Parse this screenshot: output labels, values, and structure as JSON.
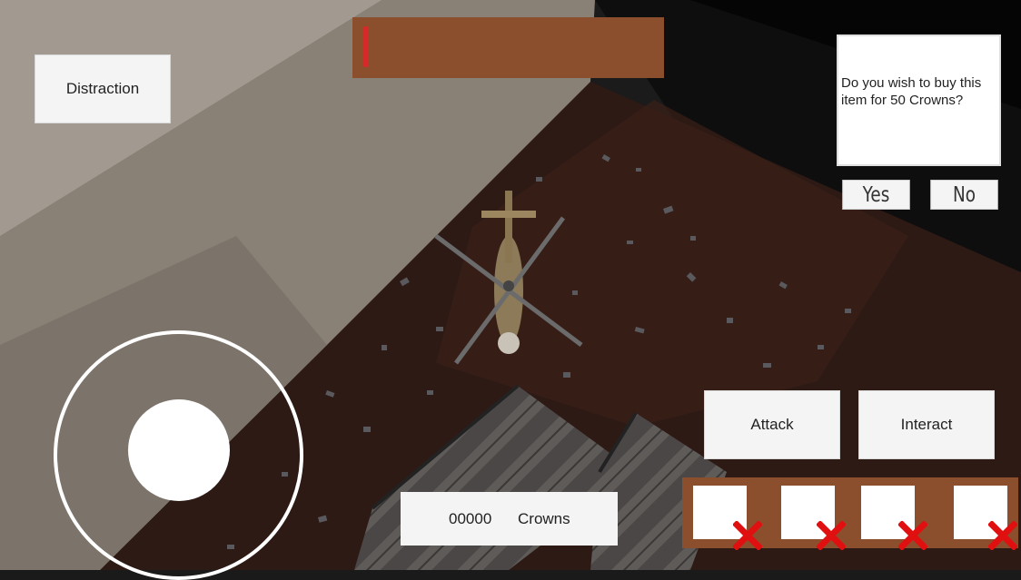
{
  "hud": {
    "distraction_label": "Distraction",
    "attack_label": "Attack",
    "interact_label": "Interact",
    "health": {
      "value": 0.02,
      "fill_color": "#d42a2a",
      "bar_color": "#8b4f2d"
    }
  },
  "shop_dialog": {
    "message": "Do you wish to buy this item for 50 Crowns?",
    "yes_label": "Yes",
    "no_label": "No"
  },
  "currency": {
    "amount": "00000",
    "label": "Crowns"
  },
  "inventory": {
    "slots": [
      {
        "item": "empty",
        "remove_icon": "red-x-icon"
      },
      {
        "item": "empty",
        "remove_icon": "red-x-icon"
      },
      {
        "item": "empty",
        "remove_icon": "red-x-icon"
      },
      {
        "item": "empty",
        "remove_icon": "red-x-icon"
      }
    ]
  },
  "joystick": {
    "ring_icon": "joystick-ring",
    "knob_icon": "joystick-knob"
  },
  "scene": {
    "player": "helicopter",
    "ground_color": "#2e1a15",
    "wall_color": "#8a8176"
  }
}
